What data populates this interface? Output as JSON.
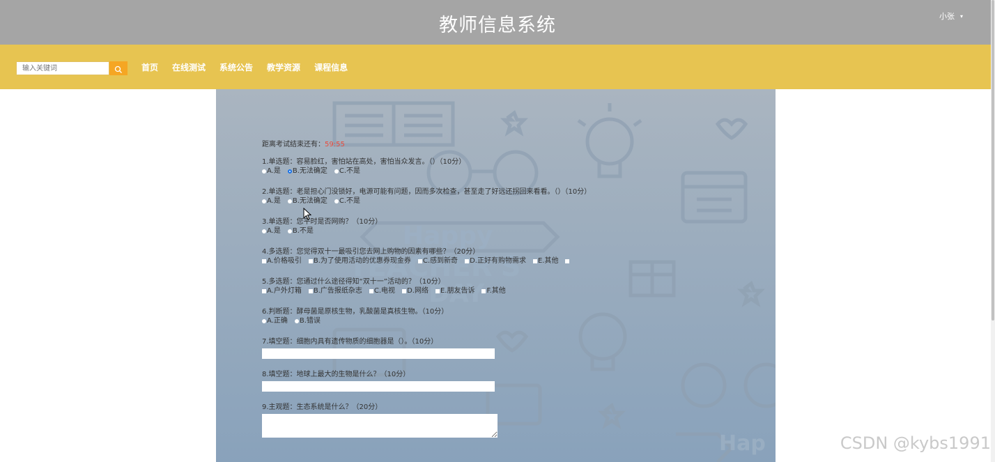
{
  "header": {
    "title": "教师信息系统",
    "user": "小张",
    "user_caret": "▾"
  },
  "nav": {
    "search_placeholder": "输入关键词",
    "links": [
      "首页",
      "在线测试",
      "系统公告",
      "教学资源",
      "课程信息"
    ]
  },
  "exam": {
    "timer_label": "距离考试结束还有：",
    "timer_value": "59:55",
    "questions": [
      {
        "title": "1.单选题：容易脸红，害怕站在高处，害怕当众发言。（）（10分）",
        "type": "radio",
        "options": [
          "A.是",
          "B.无法确定",
          "C.不是"
        ],
        "selected": 1
      },
      {
        "title": "2.单选题：老是担心门没锁好，电源可能有问题，因而多次检查，甚至走了好远还拐回来看看。（）（10分）",
        "type": "radio",
        "options": [
          "A.是",
          "B.无法确定",
          "C.不是"
        ],
        "selected": -1
      },
      {
        "title": "3.单选题：您平时是否网购？（10分）",
        "type": "radio",
        "options": [
          "A.是",
          "B.不是"
        ],
        "selected": -1
      },
      {
        "title": "4.多选题：您觉得双十一最吸引您去网上购物的因素有哪些？（20分）",
        "type": "checkbox",
        "options": [
          "A.价格吸引",
          "B.为了使用活动的优惠券现金券",
          "C.感到新奇",
          "D.正好有购物需求",
          "E.其他",
          ""
        ]
      },
      {
        "title": "5.多选题：您通过什么途径得知“双十一”活动的？（10分）",
        "type": "checkbox",
        "options": [
          "A.户外灯箱",
          "B.广告报纸杂志",
          "C.电视",
          "D.网络",
          "E.朋友告诉",
          "F.其他"
        ]
      },
      {
        "title": "6.判断题：酵母菌是原核生物，乳酸菌是真核生物。（10分）",
        "type": "radio",
        "options": [
          "A.正确",
          "B.错误"
        ],
        "selected": -1
      },
      {
        "title": "7.填空题：细胞内具有遗传物质的细胞器是（）。（10分）",
        "type": "input"
      },
      {
        "title": "8.填空题：地球上最大的生物是什么？（10分）",
        "type": "input"
      },
      {
        "title": "9.主观题：生态系统是什么？（20分）",
        "type": "textarea"
      }
    ]
  },
  "background_art": {
    "text_line1": "Happy",
    "text_line2": "TEACHER'S",
    "text_line3": "DAY",
    "corner_text": "Hap"
  },
  "watermark": "CSDN @kybs1991",
  "colors": {
    "header_bg": "#a5a5a5",
    "nav_bg": "#e7c451",
    "search_btn": "#f5a623",
    "timer": "#e84b3c"
  }
}
